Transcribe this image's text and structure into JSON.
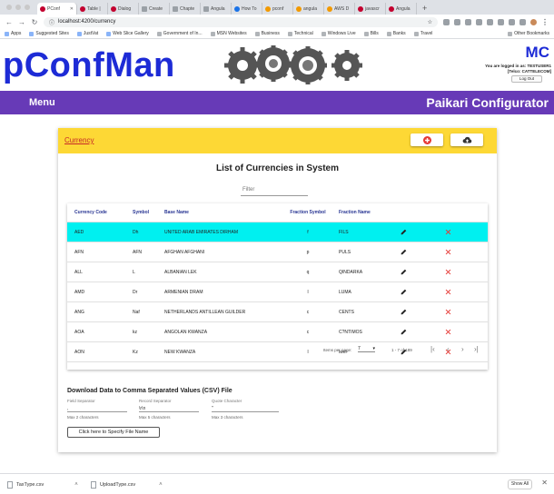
{
  "browser": {
    "tabs": [
      {
        "label": "PConf",
        "active": true
      },
      {
        "label": "Table |"
      },
      {
        "label": "Dialog"
      },
      {
        "label": "Create"
      },
      {
        "label": "Chapte"
      },
      {
        "label": "Angula"
      },
      {
        "label": "How To"
      },
      {
        "label": "pconf"
      },
      {
        "label": "angula"
      },
      {
        "label": "AWS D"
      },
      {
        "label": "javascr"
      },
      {
        "label": "Angula"
      }
    ],
    "new_tab": "+",
    "url": "localhost:4200/currency",
    "bookmarks": [
      "Apps",
      "Suggested Sites",
      "JustVat",
      "Web Slice Gallery",
      "Government of In...",
      "MSN Websites",
      "Business",
      "Technical",
      "Windows Live",
      "Bills",
      "Banks",
      "Travel"
    ],
    "other_bookmarks": "Other Bookmarks"
  },
  "header": {
    "logo": "pConfMan",
    "mc": "MC",
    "logged_in_line1": "You are logged in as: TESTUSER1",
    "logged_in_line2": "[Telco: CATTELECOM]",
    "logout": "Log Out"
  },
  "navbar": {
    "menu": "Menu",
    "app_title": "Paikari Configurator"
  },
  "breadcrumb": "Currency",
  "page_title": "List of Currencies in System",
  "filter_placeholder": "Filter",
  "table": {
    "headers": [
      "Currency Code",
      "Symbol",
      "Base Name",
      "Fraction Symbol",
      "Fraction Name"
    ],
    "rows": [
      {
        "code": "AED",
        "symbol": "Dh",
        "base": "UNITED ARAB EMIRATES DIRHAM",
        "fsym": "f",
        "fname": "FILS",
        "selected": true
      },
      {
        "code": "AFN",
        "symbol": "AFN",
        "base": "AFGHAN AFGHANI",
        "fsym": "p",
        "fname": "PULS"
      },
      {
        "code": "ALL",
        "symbol": "L",
        "base": "ALBANIAN LEK",
        "fsym": "q",
        "fname": "QINDARKA"
      },
      {
        "code": "AMD",
        "symbol": "Dr",
        "base": "ARMENIAN DRAM",
        "fsym": "l",
        "fname": "LUMA"
      },
      {
        "code": "ANG",
        "symbol": "Naf",
        "base": "NETHERLANDS ANTILLEAN GUILDER",
        "fsym": "c",
        "fname": "CENTS"
      },
      {
        "code": "AOA",
        "symbol": "kz",
        "base": "ANGOLAN KWANZA",
        "fsym": "c",
        "fname": "C?NTIMOS"
      },
      {
        "code": "AON",
        "symbol": "Kz",
        "base": "NEW KWANZA",
        "fsym": "l",
        "fname": "lwei"
      }
    ]
  },
  "paginator": {
    "items_per_page_label": "Items per page:",
    "items_per_page": "7",
    "range": "1 - 7 of 189"
  },
  "download": {
    "title": "Download Data to Comma Separated Values (CSV) File",
    "field_separator": {
      "label": "Field Separator",
      "value": ",",
      "hint": "Max 2 characters"
    },
    "record_separator": {
      "label": "Record Separator",
      "value": "\\r\\n",
      "hint": "Max 5 characters"
    },
    "quote_character": {
      "label": "Quote Character",
      "value": "\"",
      "hint": "Max 3 characters"
    },
    "button": "Click here to Specify File Name"
  },
  "downloads_shelf": {
    "files": [
      "TaxType.csv",
      "UploadType.csv"
    ],
    "show_all": "Show All"
  },
  "colors": {
    "logo_blue": "#1d2bd6",
    "nav_purple": "#673ab7",
    "card_header_yellow": "#fdd835",
    "selected_row": "#00f0f0",
    "delete_red": "#e53935"
  }
}
